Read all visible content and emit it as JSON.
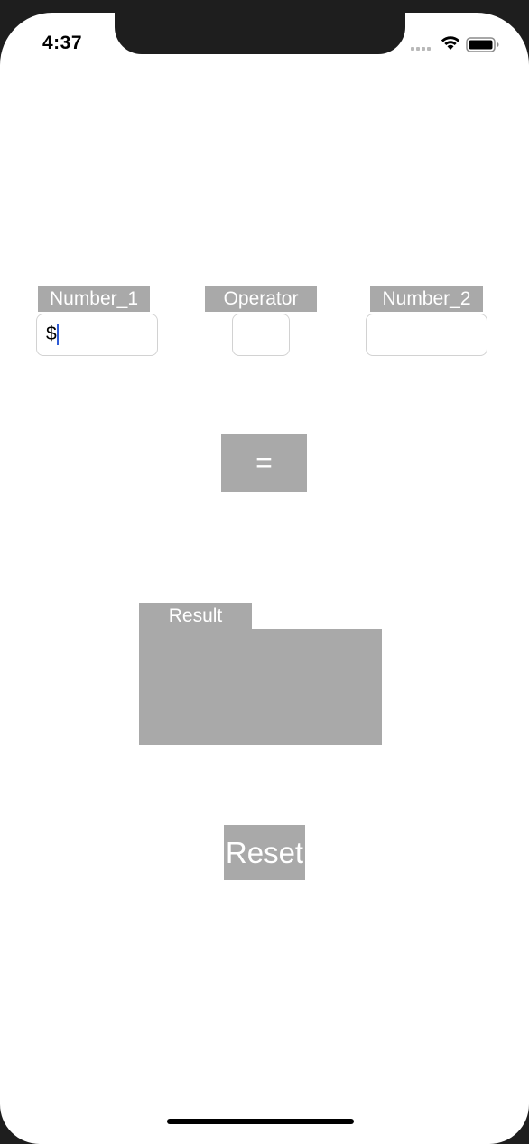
{
  "status_bar": {
    "time": "4:37",
    "wifi_icon": "wifi-icon",
    "battery_icon": "battery-icon",
    "signal_icon": "cellular-signal-icon"
  },
  "inputs": {
    "number1": {
      "label": "Number_1",
      "value": "$"
    },
    "operator": {
      "label": "Operator",
      "value": ""
    },
    "number2": {
      "label": "Number_2",
      "value": ""
    }
  },
  "equals_button": {
    "label": "="
  },
  "result": {
    "label": "Result",
    "value": ""
  },
  "reset_button": {
    "label": "Reset"
  },
  "colors": {
    "accent_gray": "#a9a9a9",
    "caret_blue": "#2f5bd6",
    "field_border": "#d2d2d2"
  }
}
